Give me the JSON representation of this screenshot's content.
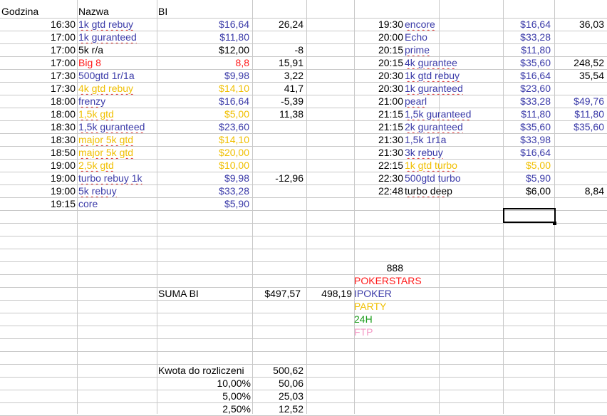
{
  "colors": {
    "blue": "#3a3aa8",
    "red": "#ff1a1a",
    "yellow": "#f0bf00",
    "green": "#1f9e1f",
    "pink": "#f49ac6",
    "black": "#000000"
  },
  "headers": {
    "godzina": "Godzina",
    "nazwa": "Nazwa",
    "bi": "BI"
  },
  "left_rows": [
    {
      "time": "16:30",
      "name": "1k gtd rebuy",
      "bi": "$16,64",
      "result": "26,24",
      "color": "blue",
      "sq": true
    },
    {
      "time": "17:00",
      "name": "1k guranteed",
      "bi": "$11,80",
      "result": "",
      "color": "blue",
      "sq": true
    },
    {
      "time": "17:00",
      "name": "5k r/a",
      "bi": "$12,00",
      "result": "-8",
      "color": "black",
      "sq": false
    },
    {
      "time": "17:00",
      "name": "Big 8",
      "bi": "8,8",
      "result": "15,91",
      "color": "red",
      "sq": false
    },
    {
      "time": "17:30",
      "name": "500gtd 1r/1a",
      "bi": "$9,98",
      "result": "3,22",
      "color": "blue",
      "sq": false
    },
    {
      "time": "17:30",
      "name": "4k gtd rebuy",
      "bi": "$14,10",
      "result": "41,7",
      "color": "yellow",
      "sq": true
    },
    {
      "time": "18:00",
      "name": "frenzy",
      "bi": "$16,64",
      "result": "-5,39",
      "color": "blue",
      "sq": true
    },
    {
      "time": "18:00",
      "name": "1,5k gtd",
      "bi": "$5,00",
      "result": "11,38",
      "color": "yellow",
      "sq": true
    },
    {
      "time": "18:30",
      "name": "1,5k guranteed",
      "bi": "$23,60",
      "result": "",
      "color": "blue",
      "sq": true
    },
    {
      "time": "18:30",
      "name": "major 5k gtd",
      "bi": "$14,10",
      "result": "",
      "color": "yellow",
      "sq": true
    },
    {
      "time": "18:50",
      "name": "major 5k gtd",
      "bi": "$20,00",
      "result": "",
      "color": "yellow",
      "sq": true
    },
    {
      "time": "19:00",
      "name": "2,5k gtd",
      "bi": "$10,00",
      "result": "",
      "color": "yellow",
      "sq": true
    },
    {
      "time": "19:00",
      "name": "turbo rebuy 1k",
      "bi": "$9,98",
      "result": "-12,96",
      "color": "blue",
      "sq": true
    },
    {
      "time": "19:00",
      "name": "5k rebuy",
      "bi": "$33,28",
      "result": "",
      "color": "blue",
      "sq": true
    },
    {
      "time": "19:15",
      "name": "core",
      "bi": "$5,90",
      "result": "",
      "color": "blue",
      "sq": false
    }
  ],
  "right_rows": [
    {
      "time": "19:30",
      "name": "encore",
      "bi": "$16,64",
      "result": "36,03",
      "color": "blue",
      "sq": true,
      "rcolor": "black"
    },
    {
      "time": "20:00",
      "name": "Echo",
      "bi": "$33,28",
      "result": "",
      "color": "blue",
      "sq": false,
      "rcolor": "black"
    },
    {
      "time": "20:15",
      "name": "prime",
      "bi": "$11,80",
      "result": "",
      "color": "blue",
      "sq": true,
      "rcolor": "black"
    },
    {
      "time": "20:15",
      "name": "4k gurantee",
      "bi": "$35,60",
      "result": "248,52",
      "color": "blue",
      "sq": true,
      "rcolor": "black"
    },
    {
      "time": "20:30",
      "name": "1k gtd rebuy",
      "bi": "$16,64",
      "result": "35,54",
      "color": "blue",
      "sq": true,
      "rcolor": "black"
    },
    {
      "time": "20:30",
      "name": "1k guranteed",
      "bi": "$23,60",
      "result": "",
      "color": "blue",
      "sq": true,
      "rcolor": "black"
    },
    {
      "time": "21:00",
      "name": "pearl",
      "bi": "$33,28",
      "result": "$49,76",
      "color": "blue",
      "sq": true,
      "rcolor": "blue"
    },
    {
      "time": "21:15",
      "name": "1,5k guranteed",
      "bi": "$11,80",
      "result": "$11,80",
      "color": "blue",
      "sq": true,
      "rcolor": "blue"
    },
    {
      "time": "21:15",
      "name": "2k guranteed",
      "bi": "$35,60",
      "result": "$35,60",
      "color": "blue",
      "sq": true,
      "rcolor": "blue"
    },
    {
      "time": "21:30",
      "name": "1,5k 1r1a",
      "bi": "$33,98",
      "result": "",
      "color": "blue",
      "sq": false,
      "rcolor": "black"
    },
    {
      "time": "21:30",
      "name": "3k rebuy",
      "bi": "$16,64",
      "result": "",
      "color": "blue",
      "sq": true,
      "rcolor": "black"
    },
    {
      "time": "22:15",
      "name": "1k gtd turbo",
      "bi": "$5,00",
      "result": "",
      "color": "yellow",
      "sq": true,
      "rcolor": "black"
    },
    {
      "time": "22:30",
      "name": "500gtd turbo",
      "bi": "$5,90",
      "result": "",
      "color": "blue",
      "sq": false,
      "rcolor": "black"
    },
    {
      "time": "22:48",
      "name": "turbo deep",
      "bi": "$6,00",
      "result": "8,84",
      "color": "black",
      "sq": true,
      "rcolor": "black"
    }
  ],
  "summary": {
    "suma_label": "SUMA BI",
    "suma_value": "$497,57",
    "suma_other": "498,19",
    "kwota_label": "Kwota do rozliczeni",
    "kwota_value": "500,62",
    "pct_rows": [
      {
        "pct": "10,00%",
        "val": "50,06"
      },
      {
        "pct": "5,00%",
        "val": "25,03"
      },
      {
        "pct": "2,50%",
        "val": "12,52"
      }
    ]
  },
  "legend": {
    "count": "888",
    "items": [
      {
        "label": "POKERSTARS",
        "color": "red"
      },
      {
        "label": "IPOKER",
        "color": "blue"
      },
      {
        "label": "PARTY",
        "color": "yellow"
      },
      {
        "label": "24H",
        "color": "green"
      },
      {
        "label": "FTP",
        "color": "pink"
      }
    ]
  }
}
